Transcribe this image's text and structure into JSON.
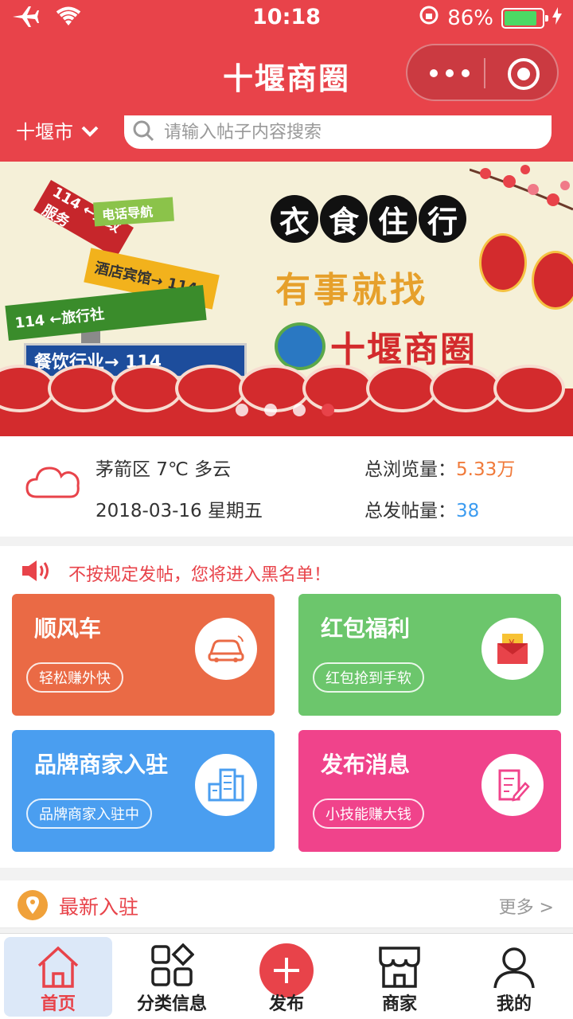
{
  "status_bar": {
    "time": "10:18",
    "battery": "86%"
  },
  "header": {
    "title": "十堰商圈",
    "city": "十堰市",
    "search_placeholder": "请输入帖子内容搜索"
  },
  "banner": {
    "slogan_chars": [
      "衣",
      "食",
      "住",
      "行"
    ],
    "slogan2": "有事就找",
    "brand": "十堰商圈",
    "signs": {
      "blue": "餐饮行业→ 114",
      "green": "114 ←旅行社",
      "yellow": "酒店宾馆→ 114",
      "red": "114 ←家政服务",
      "lime": "电话导航"
    },
    "slides": 4,
    "active_slide": 4
  },
  "info": {
    "weather": "茅箭区 7℃ 多云",
    "date": "2018-03-16 星期五",
    "views_label": "总浏览量：",
    "views_value": "5.33万",
    "posts_label": "总发帖量：",
    "posts_value": "38"
  },
  "notice": "不按规定发帖，您将进入黑名单！",
  "cards": [
    {
      "title": "顺风车",
      "tag": "轻松赚外快",
      "icon": "car-icon",
      "color": "#ea6a45"
    },
    {
      "title": "红包福利",
      "tag": "红包抢到手软",
      "icon": "red-envelope-icon",
      "color": "#6cc66c"
    },
    {
      "title": "品牌商家入驻",
      "tag": "品牌商家入驻中",
      "icon": "building-icon",
      "color": "#4a9ef0"
    },
    {
      "title": "发布消息",
      "tag": "小技能赚大钱",
      "icon": "edit-document-icon",
      "color": "#f0438b"
    }
  ],
  "latest": {
    "label": "最新入驻",
    "more": "更多 >"
  },
  "tabbar": [
    {
      "label": "首页",
      "icon": "home-icon",
      "active": true
    },
    {
      "label": "分类信息",
      "icon": "grid-icon",
      "active": false
    },
    {
      "label": "发布",
      "icon": "plus-icon",
      "active": false
    },
    {
      "label": "商家",
      "icon": "shop-icon",
      "active": false
    },
    {
      "label": "我的",
      "icon": "user-icon",
      "active": false
    }
  ],
  "colors": {
    "brand": "#e8434a",
    "views": "#f07a3a",
    "posts": "#3b9bf0"
  }
}
